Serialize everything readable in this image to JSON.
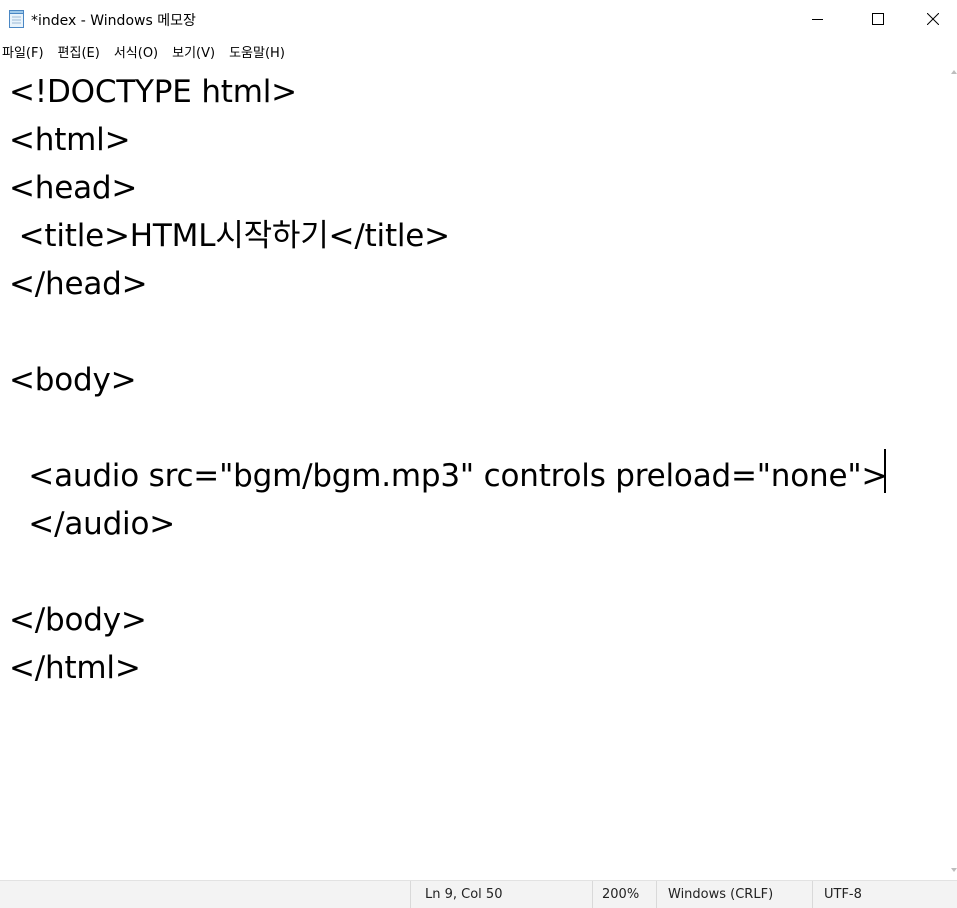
{
  "window": {
    "title": "*index - Windows 메모장",
    "icon": "notepad-icon",
    "controls": {
      "minimize": "minimize-icon",
      "maximize": "maximize-icon",
      "close": "close-icon"
    }
  },
  "menu": {
    "items": [
      {
        "label": "파일(F)"
      },
      {
        "label": "편집(E)"
      },
      {
        "label": "서식(O)"
      },
      {
        "label": "보기(V)"
      },
      {
        "label": "도움말(H)"
      }
    ]
  },
  "editor": {
    "lines": [
      "<!DOCTYPE html>",
      "<html>",
      "<head>",
      " <title>HTML시작하기</title>",
      "</head>",
      "",
      "<body>",
      "",
      "  <audio src=\"bgm/bgm.mp3\" controls preload=\"none\">",
      "  </audio>",
      "",
      "</body>",
      "</html>"
    ]
  },
  "status": {
    "position": "Ln 9, Col 50",
    "zoom": "200%",
    "line_ending": "Windows (CRLF)",
    "encoding": "UTF-8"
  }
}
